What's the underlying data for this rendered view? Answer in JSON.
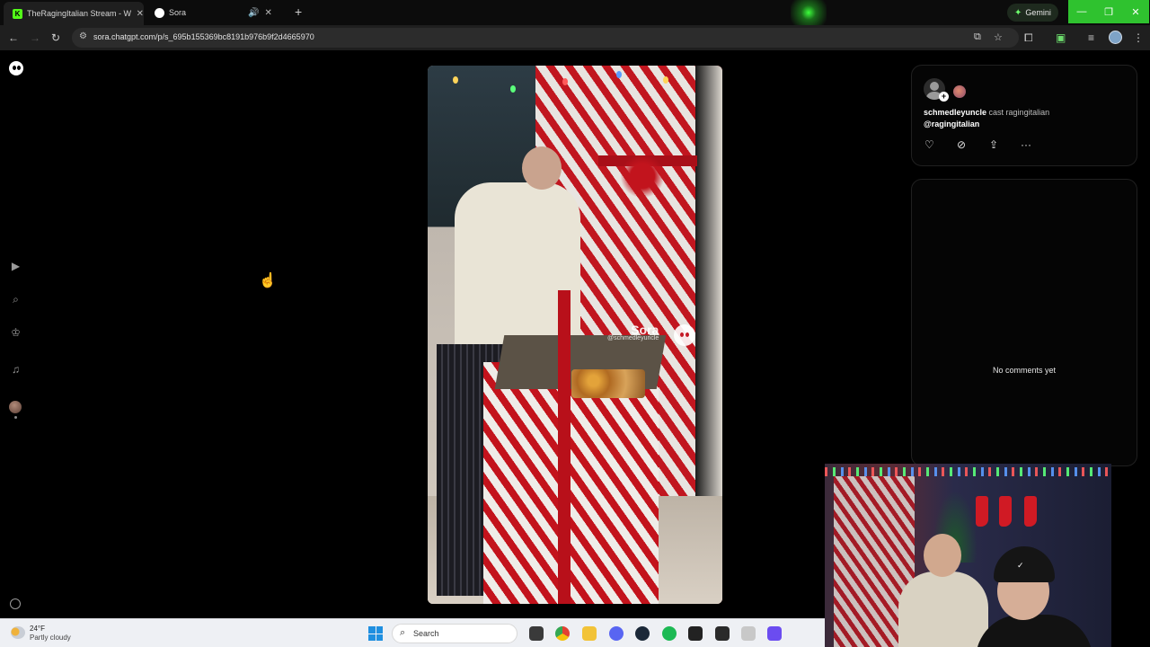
{
  "browser": {
    "tabs": [
      {
        "title": "TheRagingItalian Stream - Wa",
        "favicon": "kick-icon",
        "active": true
      },
      {
        "title": "Sora",
        "favicon": "sora-icon",
        "active": false
      }
    ],
    "gemini_label": "Gemini",
    "url": "sora.chatgpt.com/p/s_695b155369bc8191b976b9f2d4665970",
    "accent_color": "#2fc22f"
  },
  "sora": {
    "sidebar": [
      "sora-logo-icon",
      "play-icon",
      "search-icon",
      "trophy-icon",
      "bell-icon",
      "profile-avatar",
      "settings-icon"
    ],
    "video": {
      "watermark_brand": "Sora",
      "watermark_handle": "@schmedleyuncle"
    },
    "post": {
      "author": "schmedleyuncle",
      "cast_text": "cast ragingitalian",
      "mention": "@ragingitalian",
      "actions": [
        "heart-icon",
        "remix-icon",
        "share-icon",
        "more-icon"
      ]
    },
    "comments": {
      "empty_text": "No comments yet"
    }
  },
  "taskbar": {
    "weather_temp": "24°F",
    "weather_desc": "Partly cloudy",
    "search_placeholder": "Search",
    "apps": [
      "windows-icon",
      "taskview-icon",
      "chrome-icon",
      "folder-icon",
      "discord-icon",
      "steam-icon",
      "spotify-icon",
      "epic-icon",
      "robot-icon",
      "mail-icon",
      "grid-app-icon"
    ]
  }
}
